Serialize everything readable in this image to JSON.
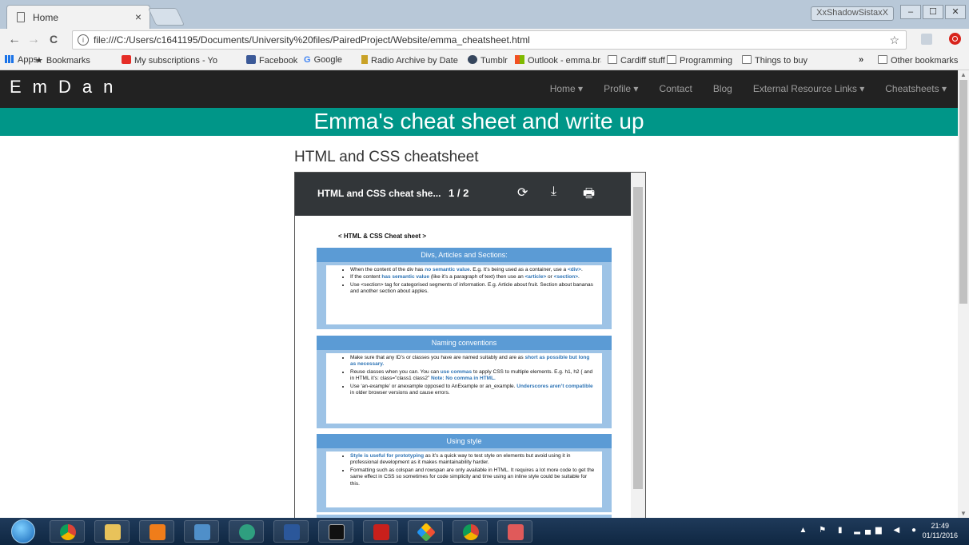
{
  "browser": {
    "tab_title": "Home",
    "tab_close": "×",
    "profile_name": "XxShadowSistaxX",
    "window_buttons": [
      "–",
      "☐",
      "✕"
    ],
    "url": "file:///C:/Users/c1641195/Documents/University%20files/PairedProject/Website/emma_cheatsheet.html",
    "info_icon": "i",
    "star_icon": "☆",
    "back": "←",
    "forward": "→",
    "reload": "C"
  },
  "bookmarks": {
    "items": [
      "Apps",
      "Bookmarks",
      "My subscriptions - Yo",
      "Facebook",
      "Google",
      "Radio Archive by Date",
      "Tumblr",
      "Outlook - emma.brad",
      "Cardiff stuff",
      "Programming",
      "Things to buy"
    ],
    "overflow": "»",
    "other": "Other bookmarks"
  },
  "site": {
    "brand": "EmDan",
    "nav": [
      "Home ▾",
      "Profile ▾",
      "Contact",
      "Blog",
      "External Resource Links ▾",
      "Cheatsheets ▾"
    ],
    "banner": "Emma's cheat sheet and write up",
    "heading": "HTML and CSS cheatsheet"
  },
  "pdf": {
    "title": "HTML and CSS cheat she...",
    "page_current": "1",
    "page_separator": "/",
    "page_total": "2",
    "doc_heading": "< HTML & CSS Cheat sheet >",
    "sections": [
      {
        "title": "Divs, Articles and Sections:",
        "bullets": [
          "When the content of the div has <b>no semantic value</b>. E.g. It’s being used as a container, use a <b><div></b>.",
          "If the content <b>has semantic value</b> (like it’s a paragraph of text) then use an <b><article></b> or <b><section></b>.",
          "Use <section> tag for categorised segments of information. E.g. Article about fruit. Section about bananas and another section about apples."
        ]
      },
      {
        "title": "Naming conventions",
        "bullets": [
          "Make sure that any ID’s or classes you have are named suitably and are as <b>short as possible but long as necessary.</b>",
          "Reuse classes when you can. You can <b>use commas</b> to apply CSS to multiple elements. E.g. h1, h2 { and in HTML it’s: class=”class1 class2” <b>Note: No comma in HTML.</b>",
          "Use ‘an-example’ or anexample opposed to AnExample or an_example. <b>Underscores aren’t compatible</b> in older browser versions and cause errors."
        ]
      },
      {
        "title": "Using style",
        "bullets": [
          "<b>Style is useful for prototyping</b> as it’s a quick way to test style on elements but avoid using it in professional development as it makes maintainability harder.",
          "Formatting such as colspan and rowspan are only available in HTML. It requires a lot more code to get the same effect in CSS so sometimes for code simplicity and time using an inline style could be suitable for this."
        ]
      }
    ]
  },
  "taskbar": {
    "apps": [
      "chrome",
      "file-explorer",
      "media-player",
      "control-panel",
      "atom",
      "word",
      "cmd",
      "acrobat",
      "git",
      "chrome",
      "snipping-tool"
    ],
    "time": "21:49",
    "date": "01/11/2016"
  },
  "colors": {
    "navbar": "#222222",
    "banner": "#009688",
    "section_header": "#5b9bd5",
    "section_frame": "#9dc3e6",
    "highlight": "#2e74b5"
  }
}
